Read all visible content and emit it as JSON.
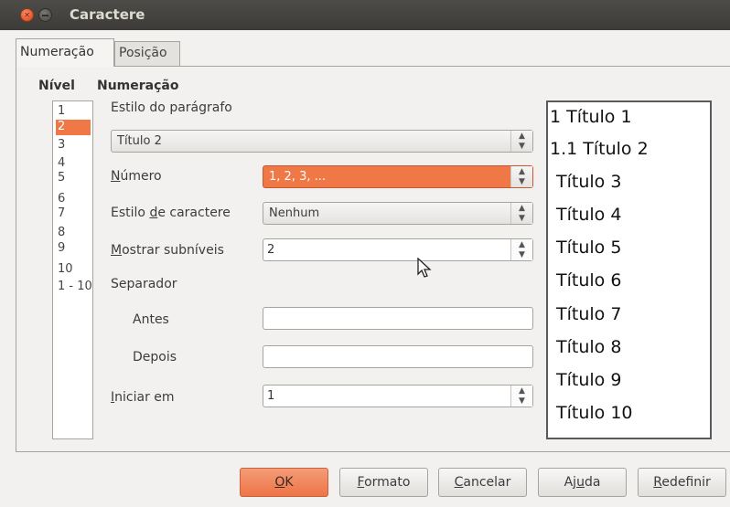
{
  "window": {
    "title": "Caractere"
  },
  "tabs": [
    {
      "label": "Numeração",
      "active": true
    },
    {
      "label": "Posição",
      "active": false
    }
  ],
  "level": {
    "header": "Nível",
    "items": [
      "1",
      "2",
      "3",
      "4",
      "5",
      "6",
      "7",
      "8",
      "9",
      "10",
      "1 - 10"
    ],
    "selected": "2"
  },
  "numbering": {
    "header": "Numeração",
    "paragraph_style_label": "Estilo do parágrafo",
    "paragraph_style_value": "Título 2",
    "number_label": "Número",
    "number_value": "1, 2, 3, ...",
    "char_style_label": "Estilo de caractere",
    "char_style_value": "Nenhum",
    "show_sublevels_label": "Mostrar subníveis",
    "show_sublevels_value": "2",
    "separator_label": "Separador",
    "before_label": "Antes",
    "before_value": "",
    "after_label": "Depois",
    "after_value": "",
    "start_at_label": "Iniciar em",
    "start_at_value": "1"
  },
  "preview": {
    "lines": [
      "1 Título 1",
      "1.1 Título 2",
      "Título 3",
      "Título 4",
      "Título 5",
      "Título 6",
      "Título 7",
      "Título 8",
      "Título 9",
      "Título 10"
    ]
  },
  "buttons": {
    "ok": "OK",
    "format": "Formato",
    "cancel": "Cancelar",
    "help": "Ajuda",
    "reset": "Redefinir"
  },
  "colors": {
    "accent": "#f07746",
    "titlebar": "#3c3b37"
  }
}
